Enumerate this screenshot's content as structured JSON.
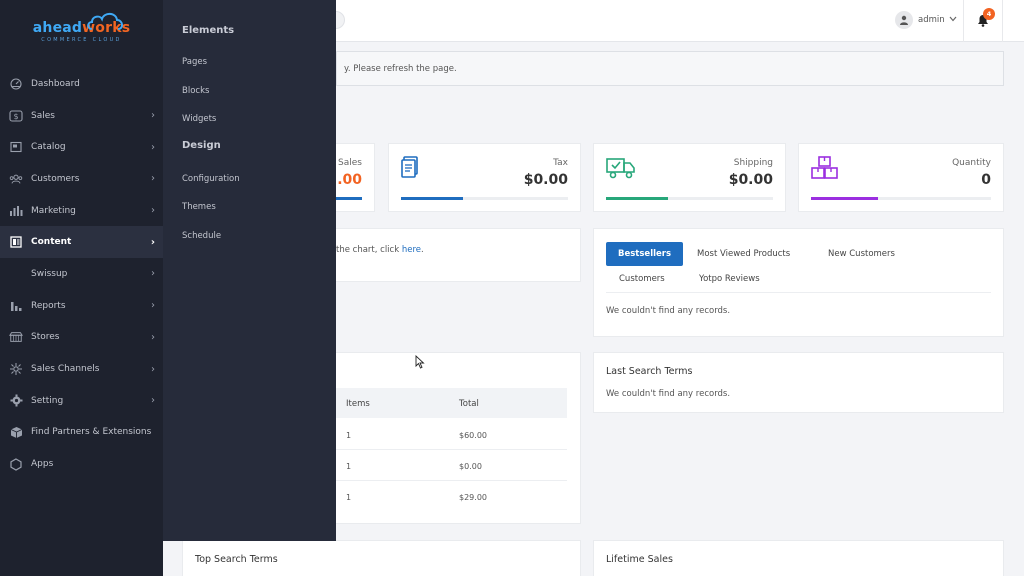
{
  "logo": {
    "part1": "ahead",
    "part2": "works",
    "tagline": "COMMERCE CLOUD"
  },
  "sidebar": {
    "items": [
      {
        "label": "Dashboard",
        "icon": "dashboard-icon",
        "has_children": false,
        "active": false
      },
      {
        "label": "Sales",
        "icon": "dollar-icon",
        "has_children": true,
        "active": false
      },
      {
        "label": "Catalog",
        "icon": "catalog-icon",
        "has_children": true,
        "active": false
      },
      {
        "label": "Customers",
        "icon": "customers-icon",
        "has_children": true,
        "active": false
      },
      {
        "label": "Marketing",
        "icon": "marketing-icon",
        "has_children": true,
        "active": false
      },
      {
        "label": "Content",
        "icon": "content-icon",
        "has_children": true,
        "active": true
      },
      {
        "label": "Swissup",
        "icon": "",
        "has_children": true,
        "active": false
      },
      {
        "label": "Reports",
        "icon": "reports-icon",
        "has_children": true,
        "active": false
      },
      {
        "label": "Stores",
        "icon": "stores-icon",
        "has_children": true,
        "active": false
      },
      {
        "label": "Sales Channels",
        "icon": "sales-channels-icon",
        "has_children": true,
        "active": false
      },
      {
        "label": "Setting",
        "icon": "gear-icon",
        "has_children": true,
        "active": false
      },
      {
        "label": "Find Partners & Extensions",
        "icon": "partners-icon",
        "has_children": false,
        "active": false
      },
      {
        "label": "Apps",
        "icon": "apps-icon",
        "has_children": false,
        "active": false
      }
    ]
  },
  "flyout": {
    "elements_heading": "Elements",
    "elements": [
      "Pages",
      "Blocks",
      "Widgets"
    ],
    "design_heading": "Design",
    "design": [
      "Configuration",
      "Themes",
      "Schedule"
    ]
  },
  "header": {
    "user": "admin",
    "notifications": "4"
  },
  "message": "y. Please refresh the page.",
  "stats": [
    {
      "label": "Sales",
      "value": ".00",
      "value_color": "#f26322",
      "bar_color": "#1f6dbf",
      "fill": 0.55
    },
    {
      "label": "Tax",
      "value": "$0.00",
      "value_color": "#333333",
      "bar_color": "#1f6dbf",
      "fill": 0.37,
      "icon": "invoice-icon",
      "icon_color": "#1f6dbf"
    },
    {
      "label": "Shipping",
      "value": "$0.00",
      "value_color": "#333333",
      "bar_color": "#27a77a",
      "fill": 0.37,
      "icon": "truck-icon",
      "icon_color": "#27a77a"
    },
    {
      "label": "Quantity",
      "value": "0",
      "value_color": "#333333",
      "bar_color": "#9b2fe0",
      "fill": 0.37,
      "icon": "boxes-icon",
      "icon_color": "#9b2fe0"
    }
  ],
  "chart_notice": {
    "text": "the chart, click ",
    "link": "here",
    "period": "."
  },
  "tabs": {
    "items": [
      "Bestsellers",
      "Most Viewed Products",
      "New Customers",
      "Customers",
      "Yotpo Reviews"
    ],
    "empty_text": "We couldn't find any records."
  },
  "last_search": {
    "title": "Last Search Terms",
    "empty_text": "We couldn't find any records."
  },
  "orders": {
    "columns": [
      "Items",
      "Total"
    ],
    "rows": [
      {
        "items": "1",
        "total": "$60.00"
      },
      {
        "items": "1",
        "total": "$0.00"
      },
      {
        "items": "1",
        "total": "$29.00"
      }
    ]
  },
  "top_search": {
    "title": "Top Search Terms"
  },
  "lifetime_sales": {
    "title": "Lifetime Sales"
  }
}
